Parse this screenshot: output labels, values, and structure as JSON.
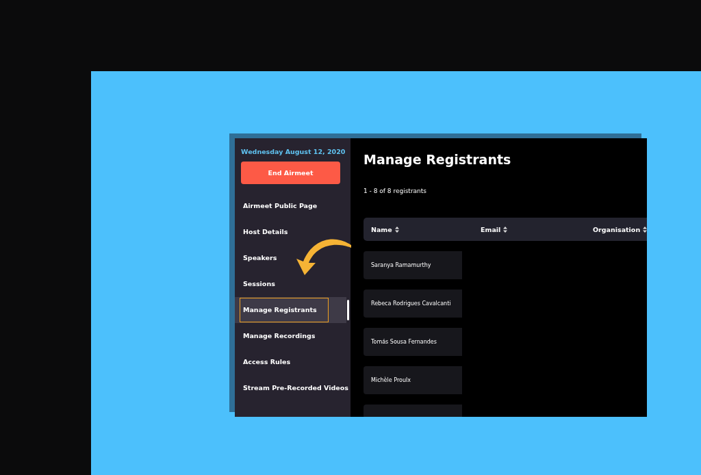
{
  "sidebar": {
    "date": "Wednesday August 12, 2020",
    "end_button": "End Airmeet",
    "items": [
      {
        "label": "Airmeet Public Page",
        "selected": false
      },
      {
        "label": "Host Details",
        "selected": false
      },
      {
        "label": "Speakers",
        "selected": false
      },
      {
        "label": "Sessions",
        "selected": false
      },
      {
        "label": "Manage Registrants",
        "selected": true
      },
      {
        "label": "Manage Recordings",
        "selected": false
      },
      {
        "label": "Access Rules",
        "selected": false
      },
      {
        "label": "Stream Pre-Recorded Videos",
        "selected": false
      }
    ]
  },
  "main": {
    "title": "Manage Registrants",
    "count": "1 - 8 of 8 registrants",
    "table": {
      "columns": [
        "Name",
        "Email",
        "Organisation"
      ],
      "rows": [
        {
          "name": "Saranya Ramamurthy"
        },
        {
          "name": "Rebeca Rodrigues Cavalcanti"
        },
        {
          "name": "Tomás Sousa Fernandes"
        },
        {
          "name": "Michèle Proulx"
        }
      ]
    }
  }
}
